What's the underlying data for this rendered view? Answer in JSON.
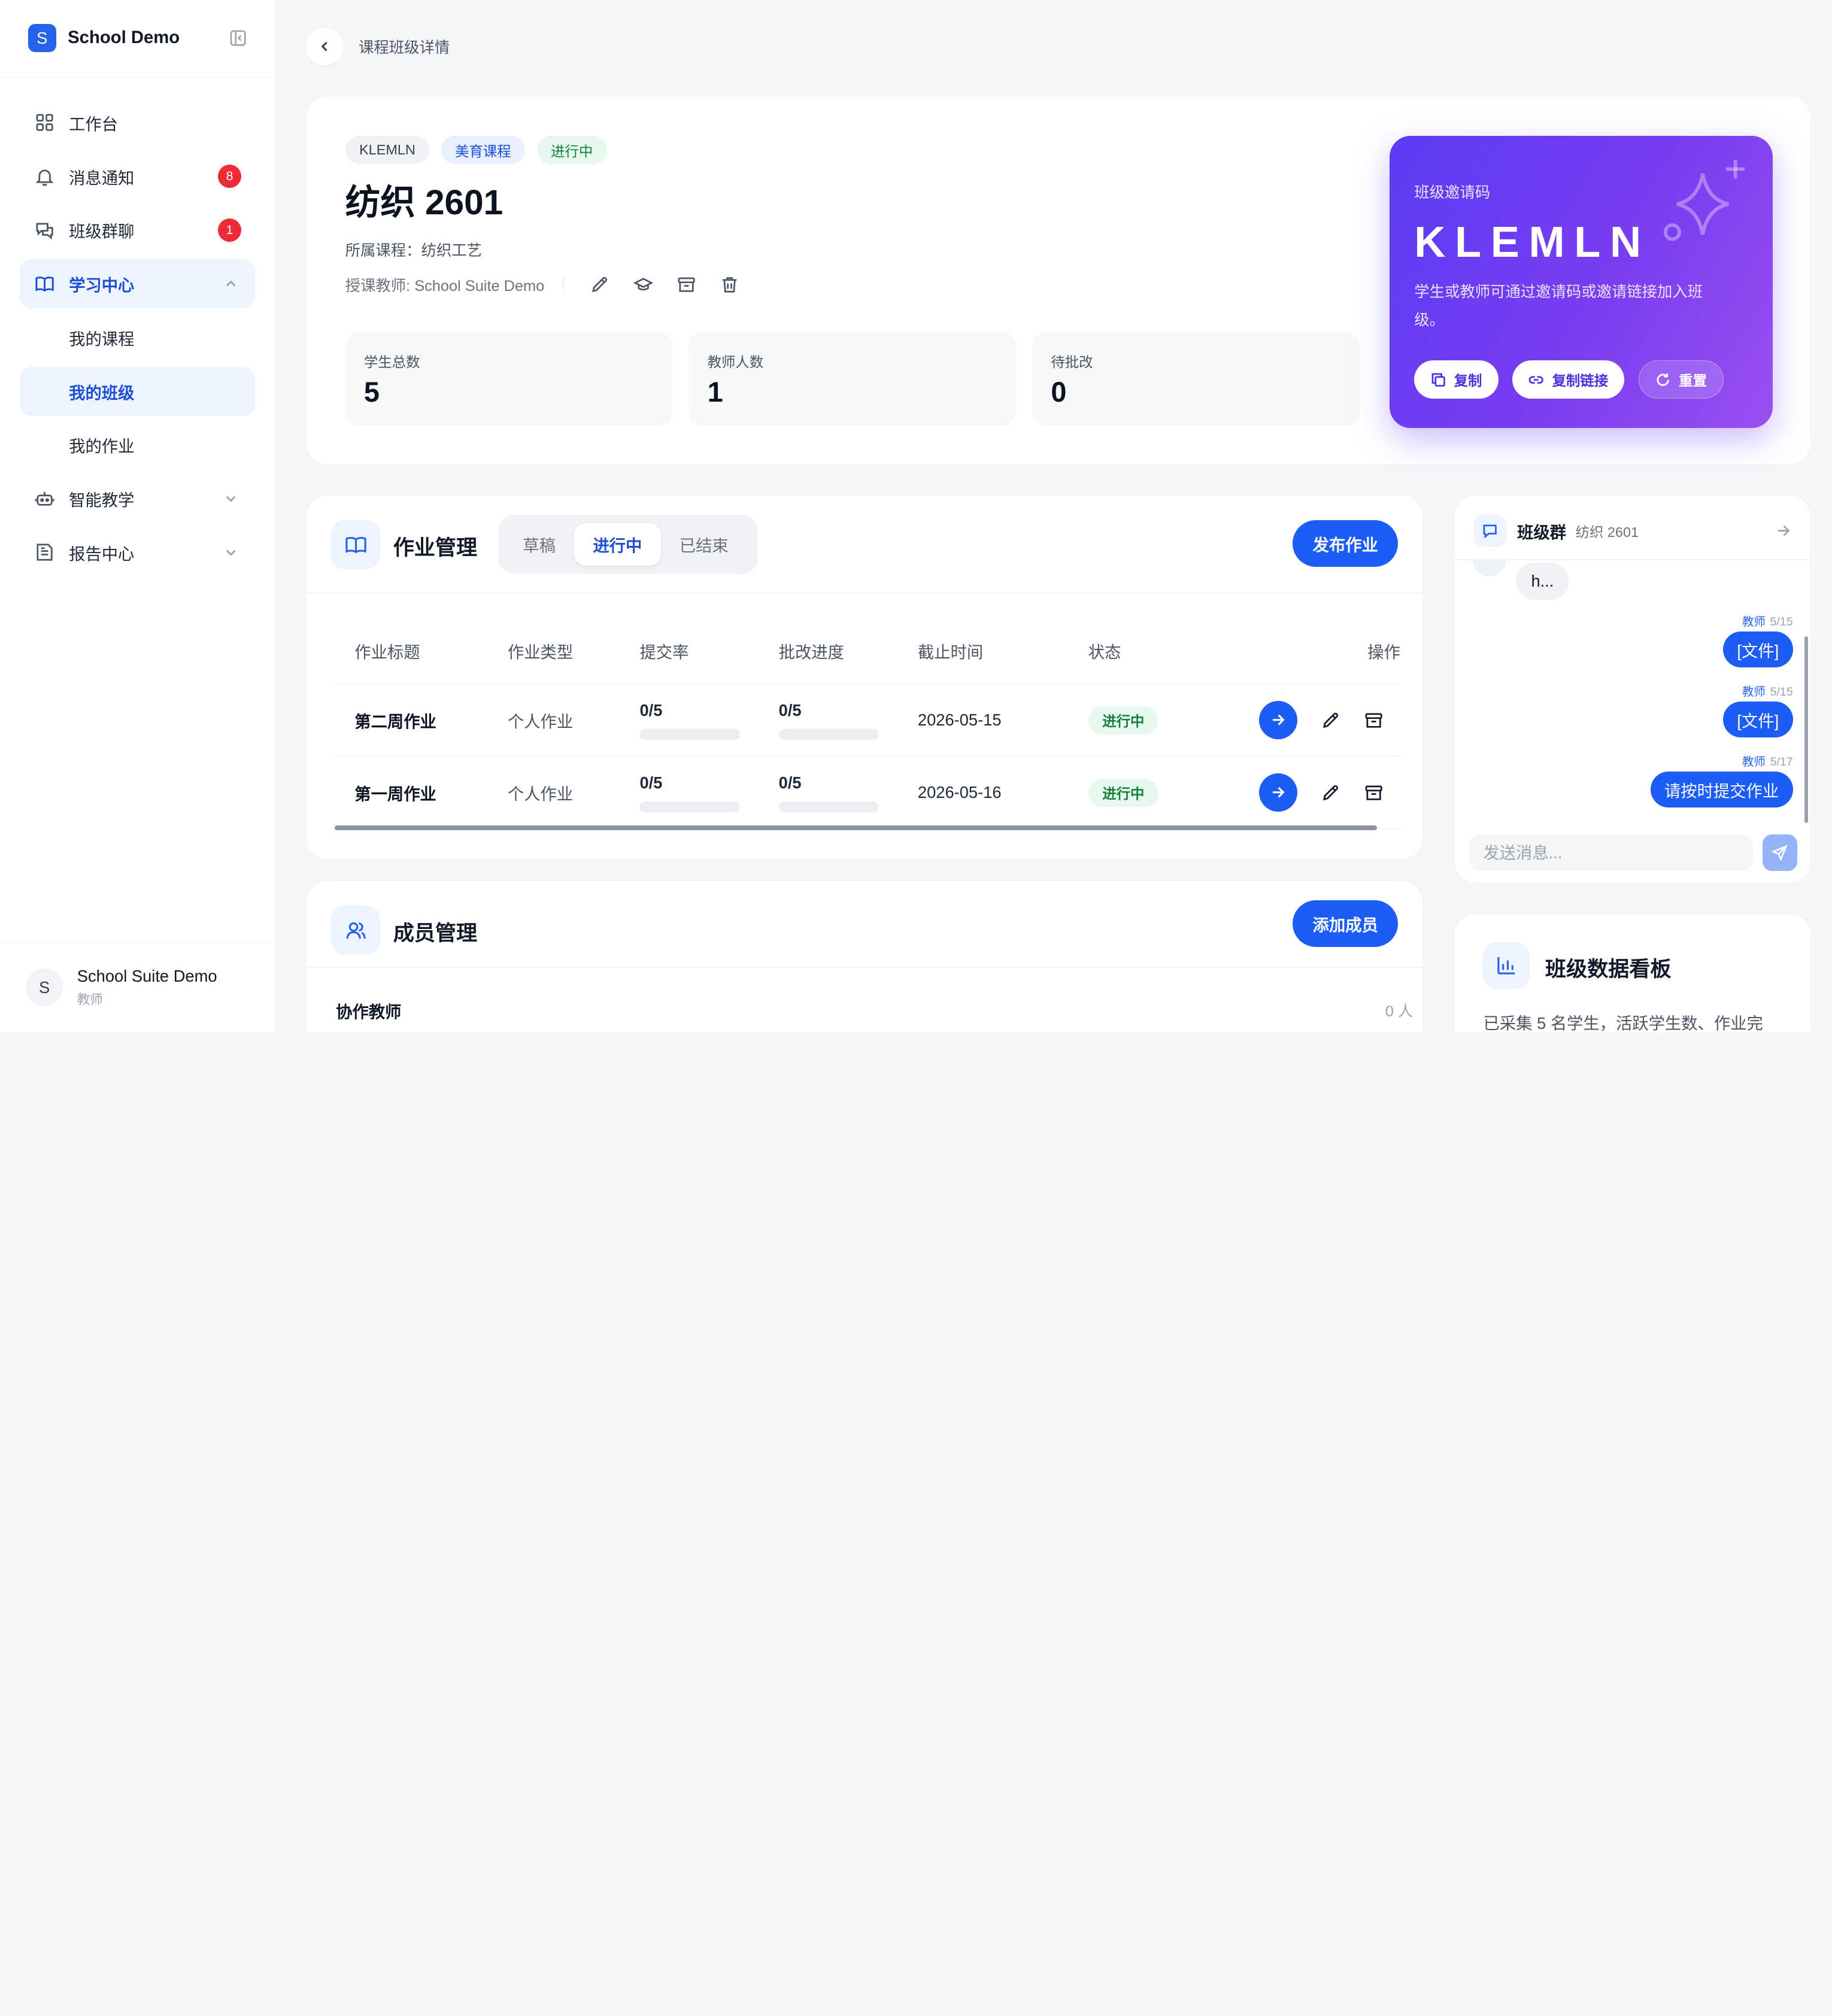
{
  "app": {
    "brand": {
      "logo_letter": "S",
      "name": "School Demo"
    },
    "colors": {
      "primary": "#1d5df5",
      "accent_gradient_start": "#5b3cf5",
      "accent_gradient_end": "#9b4ff2",
      "badge_red": "#ef2b38",
      "status_green": "#15803d"
    }
  },
  "sidebar": {
    "items": [
      {
        "label": "工作台",
        "icon": "grid-icon"
      },
      {
        "label": "消息通知",
        "icon": "bell-icon",
        "badge": "8"
      },
      {
        "label": "班级群聊",
        "icon": "chat-icon",
        "badge": "1"
      },
      {
        "label": "学习中心",
        "icon": "book-icon",
        "expanded": true
      },
      {
        "label": "我的课程"
      },
      {
        "label": "我的班级",
        "active": true
      },
      {
        "label": "我的作业"
      },
      {
        "label": "智能教学",
        "icon": "robot-icon"
      },
      {
        "label": "报告中心",
        "icon": "report-icon"
      }
    ],
    "user": {
      "avatar_letter": "S",
      "name": "School Suite Demo",
      "role": "教师"
    }
  },
  "header": {
    "breadcrumb": "课程班级详情"
  },
  "class_info": {
    "tags": [
      "KLEMLN",
      "美育课程",
      "进行中"
    ],
    "title": "纺织 2601",
    "course": "所属课程：纺织工艺",
    "teacher": "授课教师: School Suite Demo",
    "stats": [
      {
        "label": "学生总数",
        "value": "5"
      },
      {
        "label": "教师人数",
        "value": "1"
      },
      {
        "label": "待批改",
        "value": "0"
      }
    ]
  },
  "invite": {
    "label": "班级邀请码",
    "code": "KLEMLN",
    "desc": "学生或教师可通过邀请码或邀请链接加入班级。",
    "buttons": {
      "copy": "复制",
      "copy_link": "复制链接",
      "reset": "重置"
    }
  },
  "homework": {
    "title": "作业管理",
    "tabs": [
      "草稿",
      "进行中",
      "已结束"
    ],
    "active_tab": "进行中",
    "publish_button": "发布作业",
    "columns": [
      "作业标题",
      "作业类型",
      "提交率",
      "批改进度",
      "截止时间",
      "状态",
      "操作"
    ],
    "rows": [
      {
        "title": "第二周作业",
        "type": "个人作业",
        "submit": "0/5",
        "submit_fraction": 0,
        "grade": "0/5",
        "grade_fraction": 0,
        "deadline": "2026-05-15",
        "status": "进行中"
      },
      {
        "title": "第一周作业",
        "type": "个人作业",
        "submit": "0/5",
        "submit_fraction": 0,
        "grade": "0/5",
        "grade_fraction": 0,
        "deadline": "2026-05-16",
        "status": "进行中"
      }
    ]
  },
  "members": {
    "title": "成员管理",
    "add_button": "添加成员",
    "co_teachers_label": "协作教师",
    "co_teachers_count": "0 人"
  },
  "chat": {
    "title": "班级群",
    "subtitle": "纺织 2601",
    "incoming_preview": "h...",
    "messages": [
      {
        "who": "教师",
        "date": "5/15",
        "text": "[文件]"
      },
      {
        "who": "教师",
        "date": "5/15",
        "text": "[文件]"
      },
      {
        "who": "教师",
        "date": "5/17",
        "text": "请按时提交作业"
      }
    ],
    "input_placeholder": "发送消息..."
  },
  "dashboard": {
    "title": "班级数据看板",
    "desc": "已采集 5 名学生，活跃学生数、作业完"
  }
}
